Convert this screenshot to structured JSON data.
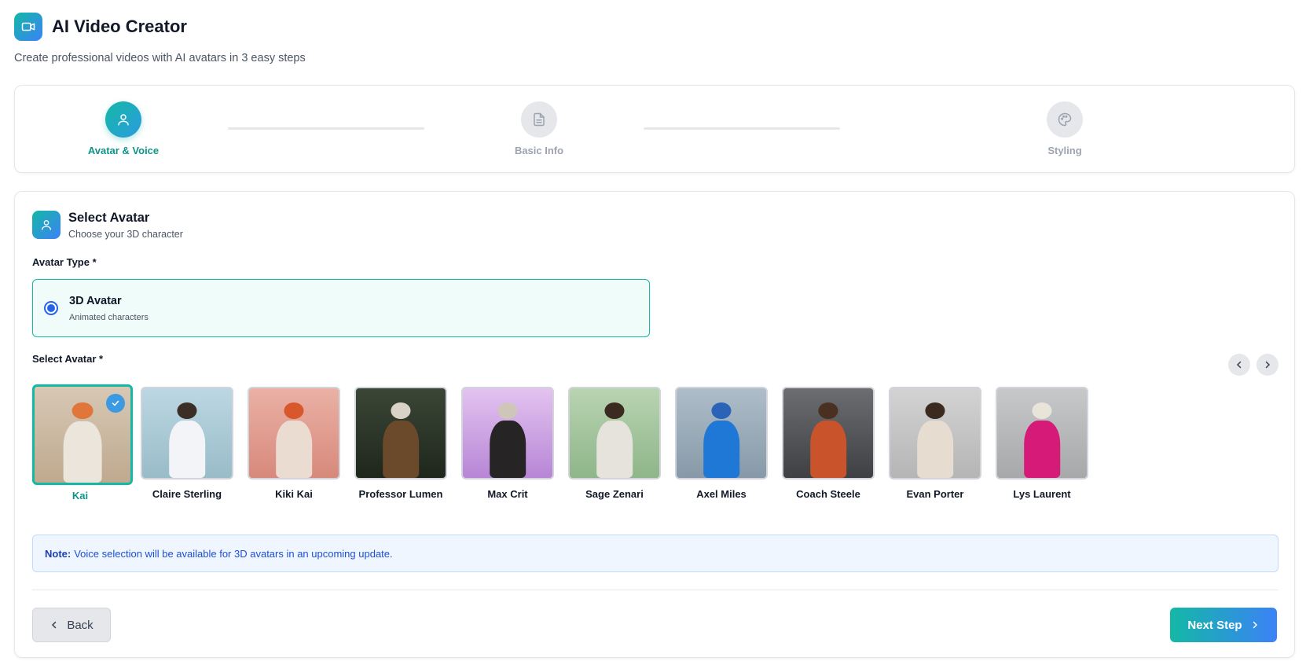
{
  "header": {
    "title": "AI Video Creator",
    "subtitle": "Create professional videos with AI avatars in 3 easy steps",
    "logo_icon": "video-camera-icon"
  },
  "stepper": {
    "steps": [
      {
        "label": "Avatar & Voice",
        "icon": "user-icon",
        "active": true
      },
      {
        "label": "Basic Info",
        "icon": "document-icon",
        "active": false
      },
      {
        "label": "Styling",
        "icon": "palette-icon",
        "active": false
      }
    ]
  },
  "section": {
    "title": "Select Avatar",
    "subtitle": "Choose your 3D character",
    "icon": "user-icon"
  },
  "avatar_type": {
    "label": "Avatar Type *",
    "option_title": "3D Avatar",
    "option_subtitle": "Animated characters",
    "selected": true
  },
  "avatar_select": {
    "label": "Select Avatar *",
    "selected": "Kai",
    "avatars": [
      {
        "name": "Kai"
      },
      {
        "name": "Claire Sterling"
      },
      {
        "name": "Kiki Kai"
      },
      {
        "name": "Professor Lumen"
      },
      {
        "name": "Max Crit"
      },
      {
        "name": "Sage Zenari"
      },
      {
        "name": "Axel Miles"
      },
      {
        "name": "Coach Steele"
      },
      {
        "name": "Evan Porter"
      },
      {
        "name": "Lys Laurent"
      }
    ]
  },
  "note": {
    "prefix": "Note:",
    "text": "Voice selection will be available for 3D avatars in an upcoming update."
  },
  "actions": {
    "back_label": "Back",
    "next_label": "Next Step"
  },
  "colors": {
    "accent_teal": "#14b8a6",
    "accent_blue": "#3b82f6",
    "note_blue": "#1d4ed8"
  }
}
